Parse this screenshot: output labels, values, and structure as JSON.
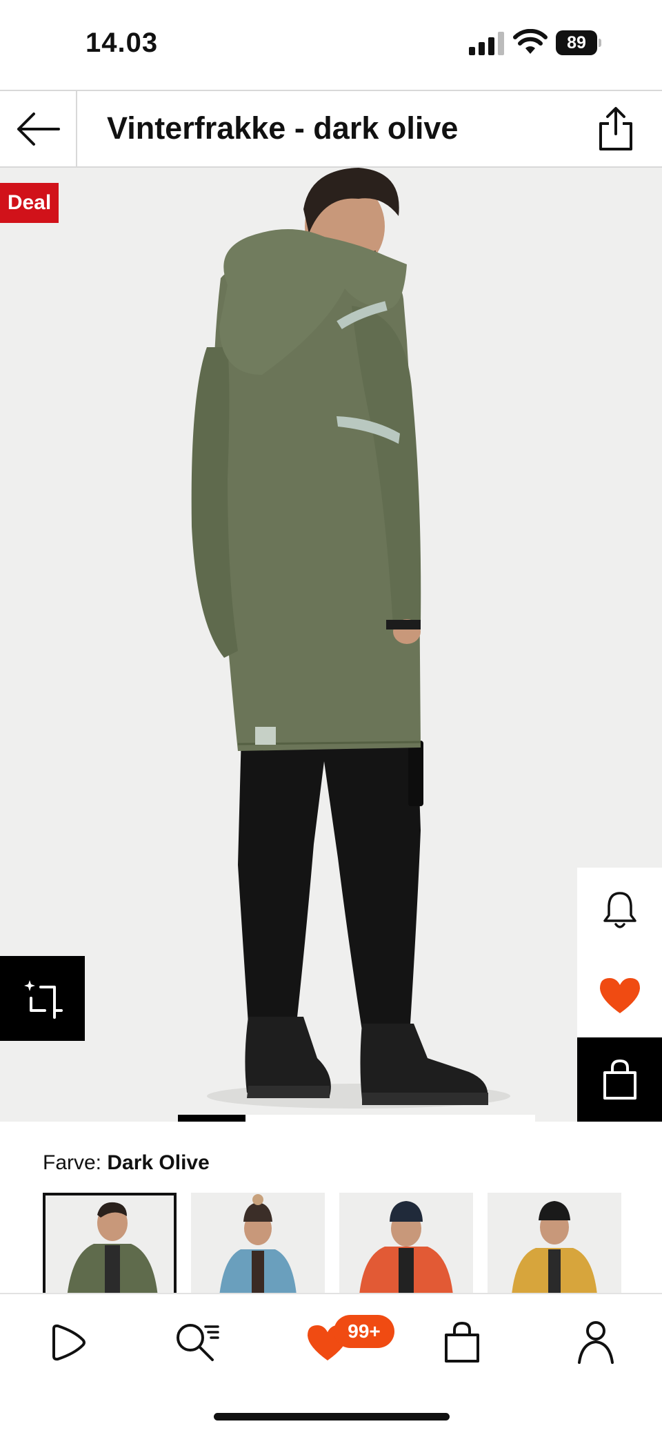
{
  "status_bar": {
    "time": "14.03",
    "battery": "89"
  },
  "header": {
    "title": "Vinterfrakke - dark olive",
    "back_icon": "arrow-left-icon",
    "share_icon": "share-icon"
  },
  "gallery": {
    "badge": "Deal",
    "image_progress": 0.19,
    "icons": {
      "ai_search": "ai-sparkle-crop-icon",
      "notify": "bell-icon",
      "favorite": "heart-icon",
      "cart": "shopping-bag-icon"
    }
  },
  "colors": {
    "label": "Farve:",
    "selected": "Dark Olive",
    "swatch_colors": [
      "#5f6b4c",
      "#6a9fbd",
      "#e25a35",
      "#d7a53c"
    ]
  },
  "bottom_nav": {
    "favorites_badge": "99+",
    "icons": [
      "play-icon",
      "search-icon",
      "heart-icon",
      "bag-icon",
      "profile-icon"
    ]
  },
  "theme": {
    "accent": "#f04b12",
    "deal_red": "#d1121a",
    "jacket": "#6b7558"
  }
}
